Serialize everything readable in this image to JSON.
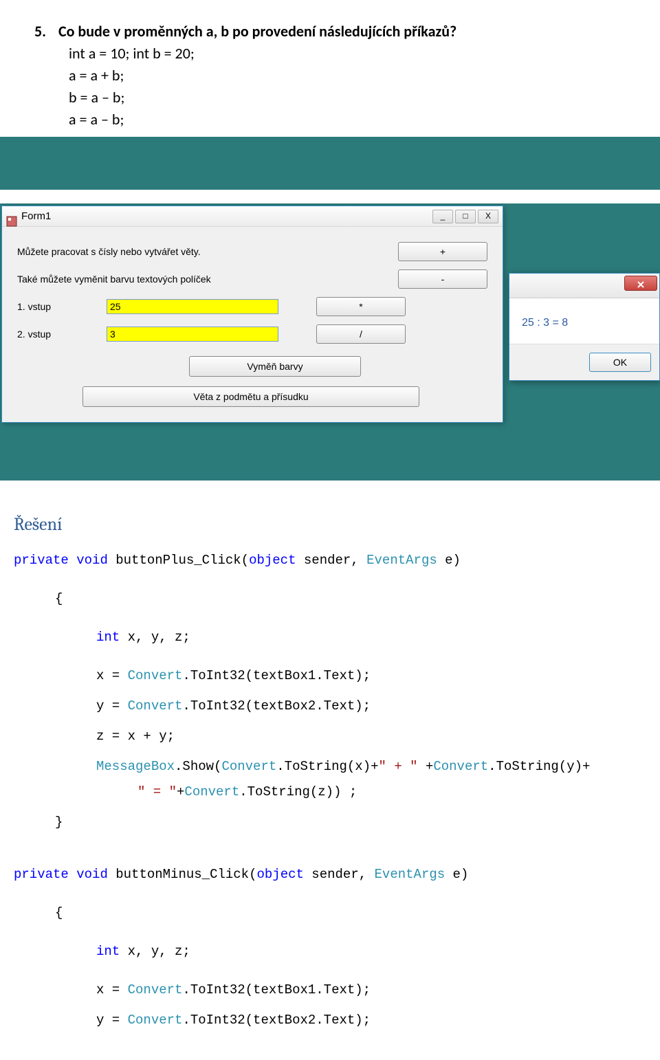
{
  "question": {
    "number": "5.",
    "text": "Co bude v proměnných a, b po provedení následujících příkazů?",
    "code_lines": [
      "int a = 10; int b = 20;",
      "a = a + b;",
      "b = a – b;",
      "a = a – b;"
    ]
  },
  "form1": {
    "title": "Form1",
    "controls": {
      "min": "_",
      "max": "□",
      "close": "X"
    },
    "label1": "Můžete pracovat s čísly nebo vytvářet věty.",
    "label2": "Také můžete vyměnit barvu textových políček",
    "vstup1_label": "1. vstup",
    "vstup1_value": "25",
    "vstup2_label": "2. vstup",
    "vstup2_value": "3",
    "btn_plus": "+",
    "btn_minus": "-",
    "btn_times": "*",
    "btn_div": "/",
    "btn_swap": "Vyměň barvy",
    "btn_sentence": "Věta z podmětu a přísudku",
    "colors": {
      "input_bg": "#ffff00"
    }
  },
  "msgbox": {
    "close": "X",
    "text": "25 : 3 = 8",
    "ok": "OK"
  },
  "solution": {
    "heading": "Řešení",
    "sig1_a": "private",
    "sig1_b": "void",
    "sig1_c": " buttonPlus_Click(",
    "sig1_d": "object",
    "sig1_e": " sender, ",
    "sig1_f": "EventArgs",
    "sig1_g": " e)",
    "l1a": "int",
    "l1b": " x, y, z;",
    "l2a": "x = ",
    "l2b": "Convert",
    "l2c": ".ToInt32(textBox1.Text);",
    "l3a": "y = ",
    "l3b": "Convert",
    "l3c": ".ToInt32(textBox2.Text);",
    "l4": "z = x + y;",
    "l5a": "MessageBox",
    "l5b": ".Show(",
    "l5c": "Convert",
    "l5d": ".ToString(x)+",
    "l5e": "\" + \"",
    "l5f": " +",
    "l5g": "Convert",
    "l5h": ".ToString(y)+",
    "l6a": "\" = \"",
    "l6b": "+",
    "l6c": "Convert",
    "l6d": ".ToString(z)) ;",
    "sig2_a": "private",
    "sig2_b": "void",
    "sig2_c": " buttonMinus_Click(",
    "sig2_d": "object",
    "sig2_e": " sender, ",
    "sig2_f": "EventArgs",
    "sig2_g": " e)",
    "m1a": "int",
    "m1b": " x, y, z;",
    "m2a": "x = ",
    "m2b": "Convert",
    "m2c": ".ToInt32(textBox1.Text);",
    "m3a": "y = ",
    "m3b": "Convert",
    "m3c": ".ToInt32(textBox2.Text);"
  }
}
